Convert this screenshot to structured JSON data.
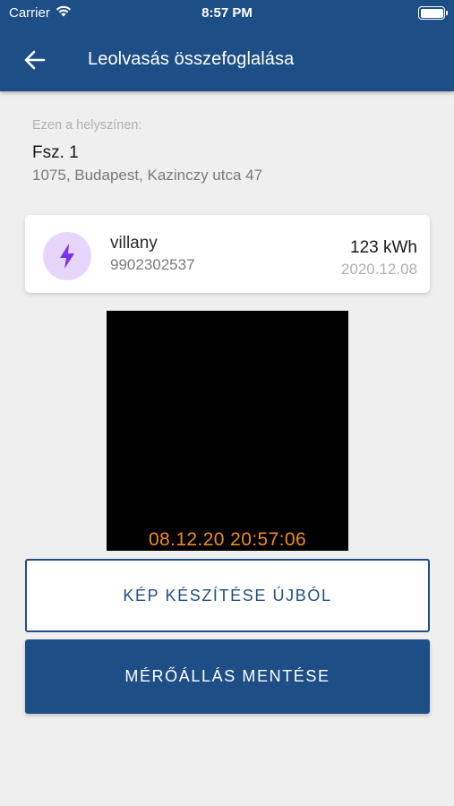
{
  "status_bar": {
    "carrier": "Carrier",
    "time": "8:57 PM",
    "wifi_icon": "wifi-icon",
    "battery_icon": "battery-icon"
  },
  "header": {
    "back_icon": "arrow-left-icon",
    "title": "Leolvasás összefoglalása"
  },
  "location": {
    "label": "Ezen a helyszínen:",
    "name": "Fsz. 1",
    "address": "1075, Budapest, Kazinczy utca 47"
  },
  "meter": {
    "icon": "lightning-icon",
    "type": "villany",
    "id": "9902302537",
    "value": "123 kWh",
    "date": "2020.12.08"
  },
  "photo": {
    "timestamp": "08.12.20 20:57:06"
  },
  "actions": {
    "retake_label": "KÉP KÉSZÍTÉSE ÚJBÓL",
    "save_label": "MÉRŐÁLLÁS MENTÉSE"
  },
  "colors": {
    "primary": "#1d4e86",
    "accent_purple": "#7b2ff2",
    "icon_bg": "#e7d6fb",
    "timestamp_orange": "#f08a20"
  }
}
